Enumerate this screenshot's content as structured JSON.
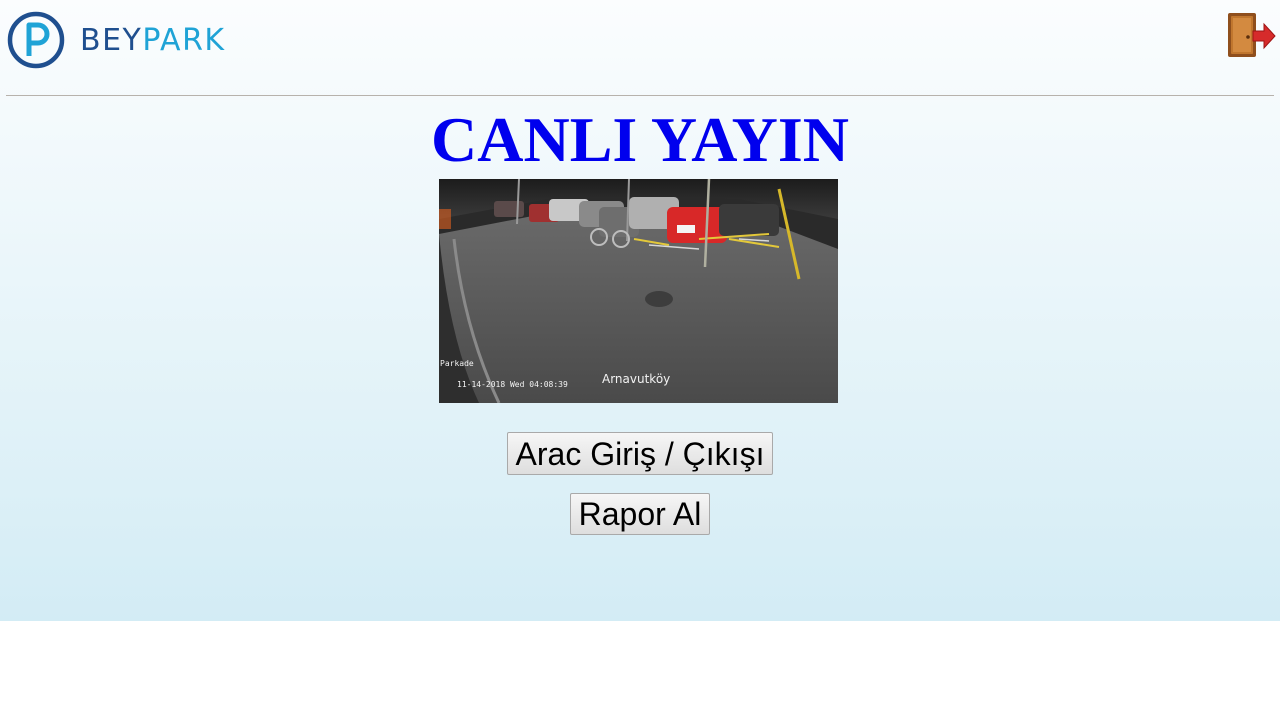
{
  "header": {
    "logo_prefix": "BEY",
    "logo_suffix": "PARK",
    "logo_icon": "parking-p-icon",
    "exit_icon": "logout-door-icon"
  },
  "main": {
    "title": "CANLI YAYIN",
    "live_feed": {
      "location": "Arnavutköy",
      "timestamp": "11-14-2018 Wed 04:08:39",
      "camera_label": "Parkade"
    },
    "buttons": {
      "entry_exit": "Arac Giriş / Çıkışı",
      "report": "Rapor Al"
    }
  },
  "colors": {
    "title": "#0000ee",
    "logo_dark": "#1f4f8f",
    "logo_light": "#1fa3d6",
    "exit_door": "#c0762e",
    "exit_arrow": "#d62b2b"
  }
}
